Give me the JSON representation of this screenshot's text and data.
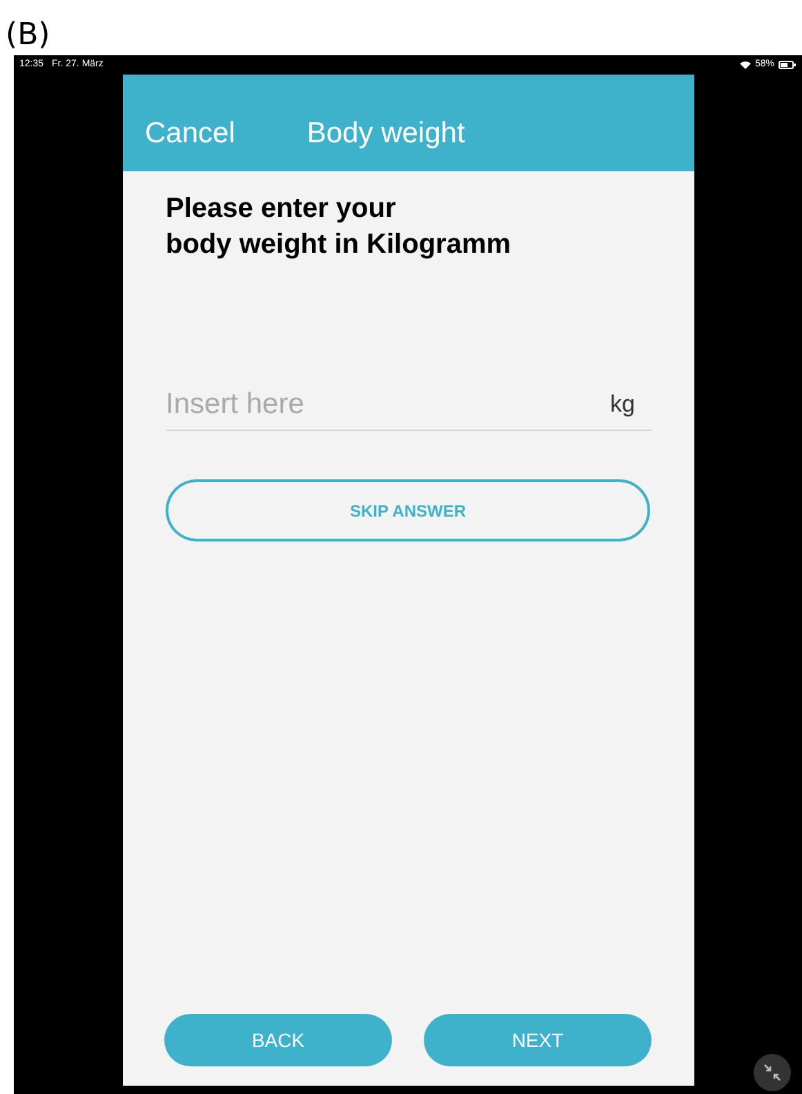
{
  "figure_label": "(B)",
  "status_bar": {
    "time": "12:35",
    "date": "Fr. 27. März",
    "battery": "58%"
  },
  "header": {
    "cancel": "Cancel",
    "title": "Body weight"
  },
  "question": [
    "Please enter your",
    "body weight in Kilogramm"
  ],
  "field": {
    "placeholder": "Insert here",
    "unit": "kg"
  },
  "skip_button": "SKIP ANSWER",
  "buttons": [
    "BACK",
    "NEXT"
  ]
}
